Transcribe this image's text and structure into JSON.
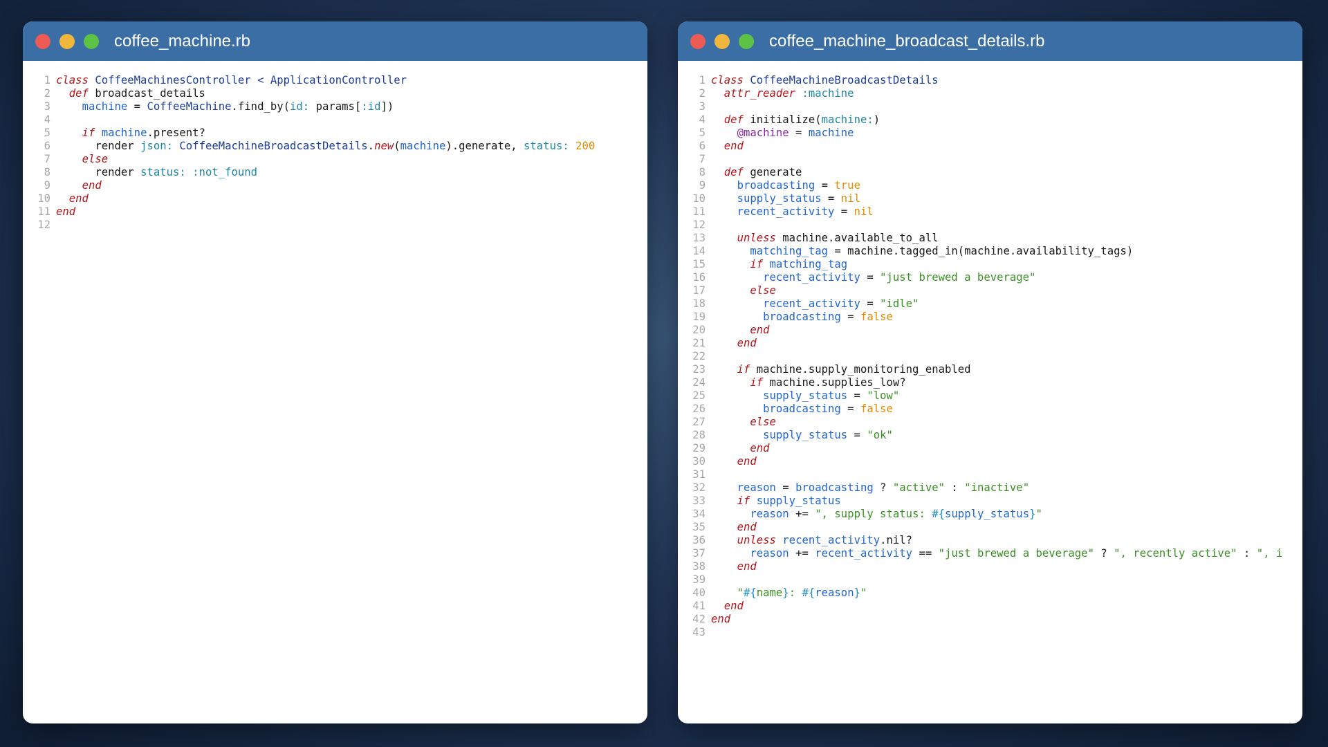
{
  "left_window": {
    "title": "coffee_machine.rb",
    "lines": [
      [
        [
          "kw",
          "class"
        ],
        [
          "t",
          " "
        ],
        [
          "cls",
          "CoffeeMachinesController"
        ],
        [
          "t",
          " "
        ],
        [
          "cls",
          "<"
        ],
        [
          "t",
          " "
        ],
        [
          "cls",
          "ApplicationController"
        ]
      ],
      [
        [
          "t",
          "  "
        ],
        [
          "kw",
          "def"
        ],
        [
          "t",
          " broadcast_details"
        ]
      ],
      [
        [
          "t",
          "    "
        ],
        [
          "var",
          "machine"
        ],
        [
          "t",
          " = "
        ],
        [
          "cls",
          "CoffeeMachine"
        ],
        [
          "t",
          ".find_by("
        ],
        [
          "sym",
          "id:"
        ],
        [
          "t",
          " params["
        ],
        [
          "sym",
          ":id"
        ],
        [
          "t",
          "])"
        ]
      ],
      [],
      [
        [
          "t",
          "    "
        ],
        [
          "kw",
          "if"
        ],
        [
          "t",
          " "
        ],
        [
          "var",
          "machine"
        ],
        [
          "t",
          ".present?"
        ]
      ],
      [
        [
          "t",
          "      render "
        ],
        [
          "sym",
          "json:"
        ],
        [
          "t",
          " "
        ],
        [
          "cls",
          "CoffeeMachineBroadcastDetails"
        ],
        [
          "t",
          "."
        ],
        [
          "kw",
          "new"
        ],
        [
          "t",
          "("
        ],
        [
          "var",
          "machine"
        ],
        [
          "t",
          ").generate, "
        ],
        [
          "sym",
          "status:"
        ],
        [
          "t",
          " "
        ],
        [
          "num",
          "200"
        ]
      ],
      [
        [
          "t",
          "    "
        ],
        [
          "kw",
          "else"
        ]
      ],
      [
        [
          "t",
          "      render "
        ],
        [
          "sym",
          "status:"
        ],
        [
          "t",
          " "
        ],
        [
          "sym",
          ":not_found"
        ]
      ],
      [
        [
          "t",
          "    "
        ],
        [
          "kw",
          "end"
        ]
      ],
      [
        [
          "t",
          "  "
        ],
        [
          "kw",
          "end"
        ]
      ],
      [
        [
          "kw",
          "end"
        ]
      ],
      []
    ]
  },
  "right_window": {
    "title": "coffee_machine_broadcast_details.rb",
    "lines": [
      [
        [
          "kw",
          "class"
        ],
        [
          "t",
          " "
        ],
        [
          "cls",
          "CoffeeMachineBroadcastDetails"
        ]
      ],
      [
        [
          "t",
          "  "
        ],
        [
          "kw",
          "attr_reader"
        ],
        [
          "t",
          " "
        ],
        [
          "sym",
          ":machine"
        ]
      ],
      [],
      [
        [
          "t",
          "  "
        ],
        [
          "kw",
          "def"
        ],
        [
          "t",
          " initialize("
        ],
        [
          "sym",
          "machine:"
        ],
        [
          "t",
          ")"
        ]
      ],
      [
        [
          "t",
          "    "
        ],
        [
          "ivar",
          "@machine"
        ],
        [
          "t",
          " = "
        ],
        [
          "var",
          "machine"
        ]
      ],
      [
        [
          "t",
          "  "
        ],
        [
          "kw",
          "end"
        ]
      ],
      [],
      [
        [
          "t",
          "  "
        ],
        [
          "kw",
          "def"
        ],
        [
          "t",
          " generate"
        ]
      ],
      [
        [
          "t",
          "    "
        ],
        [
          "var",
          "broadcasting"
        ],
        [
          "t",
          " = "
        ],
        [
          "num",
          "true"
        ]
      ],
      [
        [
          "t",
          "    "
        ],
        [
          "var",
          "supply_status"
        ],
        [
          "t",
          " = "
        ],
        [
          "num",
          "nil"
        ]
      ],
      [
        [
          "t",
          "    "
        ],
        [
          "var",
          "recent_activity"
        ],
        [
          "t",
          " = "
        ],
        [
          "num",
          "nil"
        ]
      ],
      [],
      [
        [
          "t",
          "    "
        ],
        [
          "kw",
          "unless"
        ],
        [
          "t",
          " machine.available_to_all"
        ]
      ],
      [
        [
          "t",
          "      "
        ],
        [
          "var",
          "matching_tag"
        ],
        [
          "t",
          " = machine.tagged_in(machine.availability_tags)"
        ]
      ],
      [
        [
          "t",
          "      "
        ],
        [
          "kw",
          "if"
        ],
        [
          "t",
          " "
        ],
        [
          "var",
          "matching_tag"
        ]
      ],
      [
        [
          "t",
          "        "
        ],
        [
          "var",
          "recent_activity"
        ],
        [
          "t",
          " = "
        ],
        [
          "str",
          "\"just brewed a beverage\""
        ]
      ],
      [
        [
          "t",
          "      "
        ],
        [
          "kw",
          "else"
        ]
      ],
      [
        [
          "t",
          "        "
        ],
        [
          "var",
          "recent_activity"
        ],
        [
          "t",
          " = "
        ],
        [
          "str",
          "\"idle\""
        ]
      ],
      [
        [
          "t",
          "        "
        ],
        [
          "var",
          "broadcasting"
        ],
        [
          "t",
          " = "
        ],
        [
          "num",
          "false"
        ]
      ],
      [
        [
          "t",
          "      "
        ],
        [
          "kw",
          "end"
        ]
      ],
      [
        [
          "t",
          "    "
        ],
        [
          "kw",
          "end"
        ]
      ],
      [],
      [
        [
          "t",
          "    "
        ],
        [
          "kw",
          "if"
        ],
        [
          "t",
          " machine.supply_monitoring_enabled"
        ]
      ],
      [
        [
          "t",
          "      "
        ],
        [
          "kw",
          "if"
        ],
        [
          "t",
          " machine.supplies_low?"
        ]
      ],
      [
        [
          "t",
          "        "
        ],
        [
          "var",
          "supply_status"
        ],
        [
          "t",
          " = "
        ],
        [
          "str",
          "\"low\""
        ]
      ],
      [
        [
          "t",
          "        "
        ],
        [
          "var",
          "broadcasting"
        ],
        [
          "t",
          " = "
        ],
        [
          "num",
          "false"
        ]
      ],
      [
        [
          "t",
          "      "
        ],
        [
          "kw",
          "else"
        ]
      ],
      [
        [
          "t",
          "        "
        ],
        [
          "var",
          "supply_status"
        ],
        [
          "t",
          " = "
        ],
        [
          "str",
          "\"ok\""
        ]
      ],
      [
        [
          "t",
          "      "
        ],
        [
          "kw",
          "end"
        ]
      ],
      [
        [
          "t",
          "    "
        ],
        [
          "kw",
          "end"
        ]
      ],
      [],
      [
        [
          "t",
          "    "
        ],
        [
          "var",
          "reason"
        ],
        [
          "t",
          " = "
        ],
        [
          "var",
          "broadcasting"
        ],
        [
          "t",
          " ? "
        ],
        [
          "str",
          "\"active\""
        ],
        [
          "t",
          " : "
        ],
        [
          "str",
          "\"inactive\""
        ]
      ],
      [
        [
          "t",
          "    "
        ],
        [
          "kw",
          "if"
        ],
        [
          "t",
          " "
        ],
        [
          "var",
          "supply_status"
        ]
      ],
      [
        [
          "t",
          "      "
        ],
        [
          "var",
          "reason"
        ],
        [
          "t",
          " += "
        ],
        [
          "str",
          "\", supply status: "
        ],
        [
          "interp",
          "#{"
        ],
        [
          "var",
          "supply_status"
        ],
        [
          "interp",
          "}"
        ],
        [
          "str",
          "\""
        ]
      ],
      [
        [
          "t",
          "    "
        ],
        [
          "kw",
          "end"
        ]
      ],
      [
        [
          "t",
          "    "
        ],
        [
          "kw",
          "unless"
        ],
        [
          "t",
          " "
        ],
        [
          "var",
          "recent_activity"
        ],
        [
          "t",
          ".nil?"
        ]
      ],
      [
        [
          "t",
          "      "
        ],
        [
          "var",
          "reason"
        ],
        [
          "t",
          " += "
        ],
        [
          "var",
          "recent_activity"
        ],
        [
          "t",
          " == "
        ],
        [
          "str",
          "\"just brewed a beverage\""
        ],
        [
          "t",
          " ? "
        ],
        [
          "str",
          "\", recently active\""
        ],
        [
          "t",
          " : "
        ],
        [
          "str",
          "\", i"
        ]
      ],
      [
        [
          "t",
          "    "
        ],
        [
          "kw",
          "end"
        ]
      ],
      [],
      [
        [
          "t",
          "    "
        ],
        [
          "str",
          "\""
        ],
        [
          "interp",
          "#{"
        ],
        [
          "str",
          "name"
        ],
        [
          "interp",
          "}"
        ],
        [
          "str",
          ": "
        ],
        [
          "interp",
          "#{"
        ],
        [
          "var",
          "reason"
        ],
        [
          "interp",
          "}"
        ],
        [
          "str",
          "\""
        ]
      ],
      [
        [
          "t",
          "  "
        ],
        [
          "kw",
          "end"
        ]
      ],
      [
        [
          "kw",
          "end"
        ]
      ],
      []
    ]
  }
}
